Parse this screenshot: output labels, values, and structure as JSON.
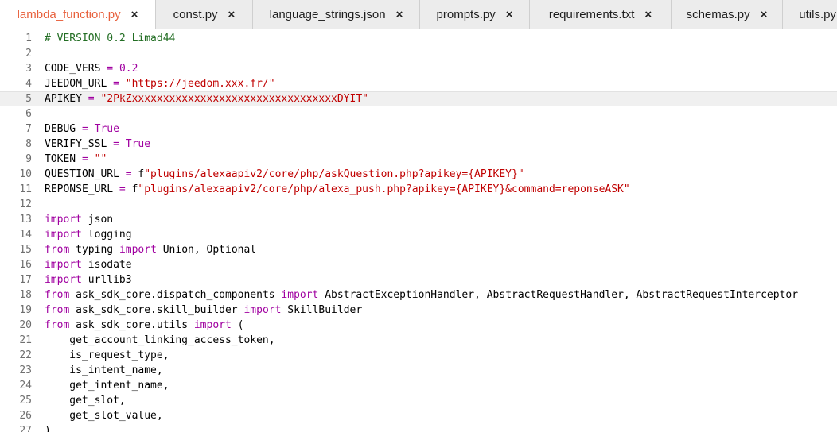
{
  "tabs": [
    {
      "label": "lambda_function.py",
      "active": true
    },
    {
      "label": "const.py"
    },
    {
      "label": "language_strings.json"
    },
    {
      "label": "prompts.py"
    },
    {
      "label": "requirements.txt"
    },
    {
      "label": "schemas.py"
    },
    {
      "label": "utils.py"
    }
  ],
  "close_glyph": "×",
  "editor": {
    "active_line": 5,
    "lines": [
      {
        "n": "1",
        "tokens": [
          {
            "t": "# VERSION 0.2 Limad44",
            "c": "comment"
          }
        ]
      },
      {
        "n": "2",
        "tokens": []
      },
      {
        "n": "3",
        "tokens": [
          {
            "t": "CODE_VERS ",
            "c": "plain"
          },
          {
            "t": "=",
            "c": "op"
          },
          {
            "t": " ",
            "c": "plain"
          },
          {
            "t": "0.2",
            "c": "num"
          }
        ]
      },
      {
        "n": "4",
        "tokens": [
          {
            "t": "JEEDOM_URL ",
            "c": "plain"
          },
          {
            "t": "=",
            "c": "op"
          },
          {
            "t": " ",
            "c": "plain"
          },
          {
            "t": "\"https://jeedom.xxx.fr/\"",
            "c": "str"
          }
        ]
      },
      {
        "n": "5",
        "tokens": [
          {
            "t": "APIKEY ",
            "c": "plain"
          },
          {
            "t": "=",
            "c": "op"
          },
          {
            "t": " ",
            "c": "plain"
          },
          {
            "t": "\"2PkZxxxxxxxxxxxxxxxxxxxxxxxxxxxxxxxxx",
            "c": "str"
          },
          {
            "t": "",
            "c": "caret"
          },
          {
            "t": "DYIT\"",
            "c": "str"
          }
        ]
      },
      {
        "n": "6",
        "tokens": []
      },
      {
        "n": "7",
        "tokens": [
          {
            "t": "DEBUG ",
            "c": "plain"
          },
          {
            "t": "=",
            "c": "op"
          },
          {
            "t": " ",
            "c": "plain"
          },
          {
            "t": "True",
            "c": "kw"
          }
        ]
      },
      {
        "n": "8",
        "tokens": [
          {
            "t": "VERIFY_SSL ",
            "c": "plain"
          },
          {
            "t": "=",
            "c": "op"
          },
          {
            "t": " ",
            "c": "plain"
          },
          {
            "t": "True",
            "c": "kw"
          }
        ]
      },
      {
        "n": "9",
        "tokens": [
          {
            "t": "TOKEN ",
            "c": "plain"
          },
          {
            "t": "=",
            "c": "op"
          },
          {
            "t": " ",
            "c": "plain"
          },
          {
            "t": "\"\"",
            "c": "str"
          }
        ]
      },
      {
        "n": "10",
        "tokens": [
          {
            "t": "QUESTION_URL ",
            "c": "plain"
          },
          {
            "t": "=",
            "c": "op"
          },
          {
            "t": " f",
            "c": "plain"
          },
          {
            "t": "\"plugins/alexaapiv2/core/php/askQuestion.php?apikey={APIKEY}\"",
            "c": "str"
          }
        ]
      },
      {
        "n": "11",
        "tokens": [
          {
            "t": "REPONSE_URL ",
            "c": "plain"
          },
          {
            "t": "=",
            "c": "op"
          },
          {
            "t": " f",
            "c": "plain"
          },
          {
            "t": "\"plugins/alexaapiv2/core/php/alexa_push.php?apikey={APIKEY}&command=reponseASK\"",
            "c": "str"
          }
        ]
      },
      {
        "n": "12",
        "tokens": []
      },
      {
        "n": "13",
        "tokens": [
          {
            "t": "import",
            "c": "kw"
          },
          {
            "t": " json",
            "c": "plain"
          }
        ]
      },
      {
        "n": "14",
        "tokens": [
          {
            "t": "import",
            "c": "kw"
          },
          {
            "t": " logging",
            "c": "plain"
          }
        ]
      },
      {
        "n": "15",
        "tokens": [
          {
            "t": "from",
            "c": "kw"
          },
          {
            "t": " typing ",
            "c": "plain"
          },
          {
            "t": "import",
            "c": "kw"
          },
          {
            "t": " Union, Optional",
            "c": "plain"
          }
        ]
      },
      {
        "n": "16",
        "tokens": [
          {
            "t": "import",
            "c": "kw"
          },
          {
            "t": " isodate",
            "c": "plain"
          }
        ]
      },
      {
        "n": "17",
        "tokens": [
          {
            "t": "import",
            "c": "kw"
          },
          {
            "t": " urllib3",
            "c": "plain"
          }
        ]
      },
      {
        "n": "18",
        "tokens": [
          {
            "t": "from",
            "c": "kw"
          },
          {
            "t": " ask_sdk_core.dispatch_components ",
            "c": "plain"
          },
          {
            "t": "import",
            "c": "kw"
          },
          {
            "t": " AbstractExceptionHandler, AbstractRequestHandler, AbstractRequestInterceptor",
            "c": "plain"
          }
        ]
      },
      {
        "n": "19",
        "tokens": [
          {
            "t": "from",
            "c": "kw"
          },
          {
            "t": " ask_sdk_core.skill_builder ",
            "c": "plain"
          },
          {
            "t": "import",
            "c": "kw"
          },
          {
            "t": " SkillBuilder",
            "c": "plain"
          }
        ]
      },
      {
        "n": "20",
        "tokens": [
          {
            "t": "from",
            "c": "kw"
          },
          {
            "t": " ask_sdk_core.utils ",
            "c": "plain"
          },
          {
            "t": "import",
            "c": "kw"
          },
          {
            "t": " (",
            "c": "plain"
          }
        ]
      },
      {
        "n": "21",
        "tokens": [
          {
            "t": "    get_account_linking_access_token,",
            "c": "plain"
          }
        ]
      },
      {
        "n": "22",
        "tokens": [
          {
            "t": "    is_request_type,",
            "c": "plain"
          }
        ]
      },
      {
        "n": "23",
        "tokens": [
          {
            "t": "    is_intent_name,",
            "c": "plain"
          }
        ]
      },
      {
        "n": "24",
        "tokens": [
          {
            "t": "    get_intent_name,",
            "c": "plain"
          }
        ]
      },
      {
        "n": "25",
        "tokens": [
          {
            "t": "    get_slot,",
            "c": "plain"
          }
        ]
      },
      {
        "n": "26",
        "tokens": [
          {
            "t": "    get_slot_value,",
            "c": "plain"
          }
        ]
      },
      {
        "n": "27",
        "tokens": [
          {
            "t": ")",
            "c": "plain"
          }
        ]
      }
    ]
  }
}
